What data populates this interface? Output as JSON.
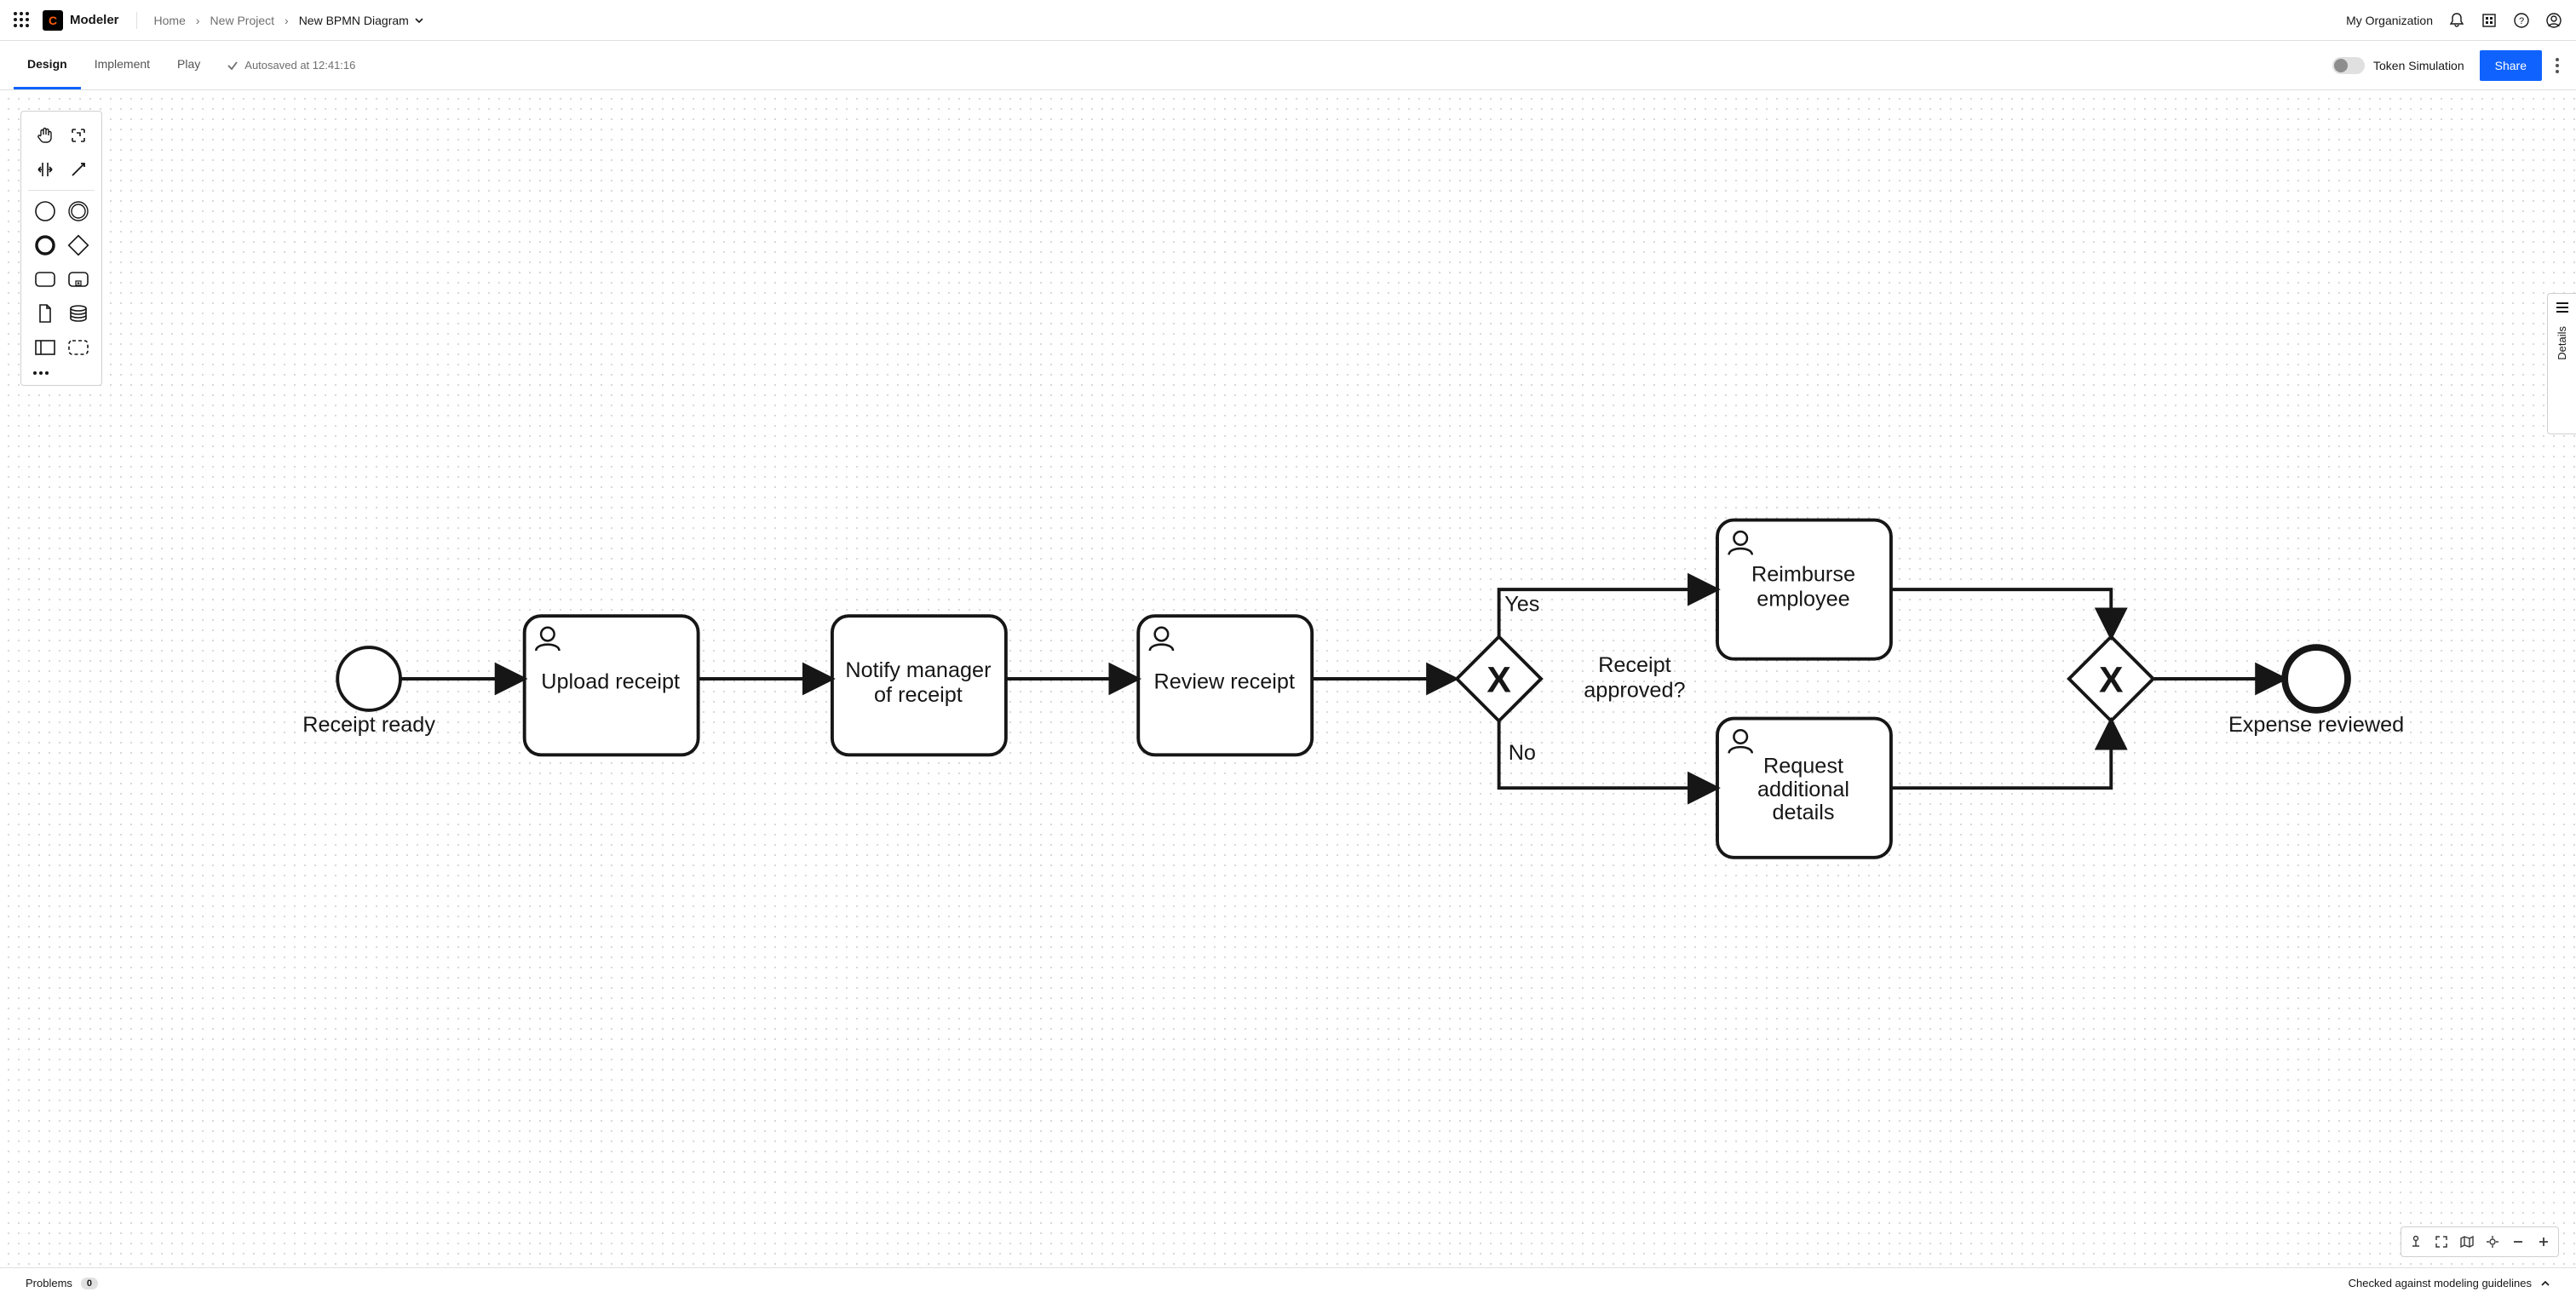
{
  "app": {
    "title": "Modeler"
  },
  "breadcrumb": {
    "home": "Home",
    "project": "New Project",
    "diagram": "New BPMN Diagram"
  },
  "header": {
    "org": "My Organization"
  },
  "tabs": {
    "design": "Design",
    "implement": "Implement",
    "play": "Play"
  },
  "autosave": "Autosaved at 12:41:16",
  "token_sim": "Token Simulation",
  "share": "Share",
  "details": "Details",
  "footer": {
    "problems": "Problems",
    "problems_count": "0",
    "guidelines": "Checked against modeling guidelines"
  },
  "diagram": {
    "start_event": "Receipt ready",
    "task1": "Upload receipt",
    "task2_l1": "Notify manager",
    "task2_l2": "of receipt",
    "task3": "Review receipt",
    "gateway1_l1": "Receipt",
    "gateway1_l2": "approved?",
    "yes": "Yes",
    "no": "No",
    "task4_l1": "Reimburse",
    "task4_l2": "employee",
    "task5_l1": "Request",
    "task5_l2": "additional",
    "task5_l3": "details",
    "end_event": "Expense reviewed"
  }
}
